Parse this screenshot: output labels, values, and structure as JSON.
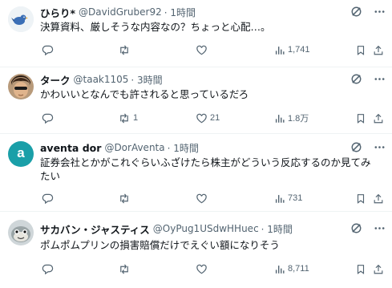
{
  "tweets": [
    {
      "name": "ひらり*",
      "handle": "@DavidGruber92",
      "time": "· 1時間",
      "text": "決算資料、厳しそうな内容なの？ちょっと心配…。",
      "replies": "",
      "retweets": "",
      "likes": "",
      "views": "1,741",
      "avatar": "blue-bird-avatar"
    },
    {
      "name": "ターク",
      "handle": "@taak1105",
      "time": "· 3時間",
      "text": "かわいいとなんでも許されると思っているだろ",
      "replies": "",
      "retweets": "1",
      "likes": "21",
      "views": "1.8万",
      "avatar": "photo-avatar"
    },
    {
      "name": "aventa dor",
      "handle": "@DorAventa",
      "time": "· 1時間",
      "text": "証券会社とかがこれぐらいふざけたら株主がどういう反応するのか見てみたい",
      "replies": "",
      "retweets": "",
      "likes": "",
      "views": "731",
      "avatar_letter": "a",
      "avatar_color": "#1a9fa8"
    },
    {
      "name": "サカバン・ジャスティス",
      "handle": "@OyPug1USdwHHuec",
      "time": "· 1時間",
      "text": "ポムポムプリンの損害賠償だけでえぐい額になりそう",
      "replies": "",
      "retweets": "",
      "likes": "",
      "views": "8,711",
      "avatar": "fish-avatar"
    }
  ],
  "colors": {
    "text": "#0f1419",
    "muted": "#536471",
    "divider": "#eff3f4"
  }
}
